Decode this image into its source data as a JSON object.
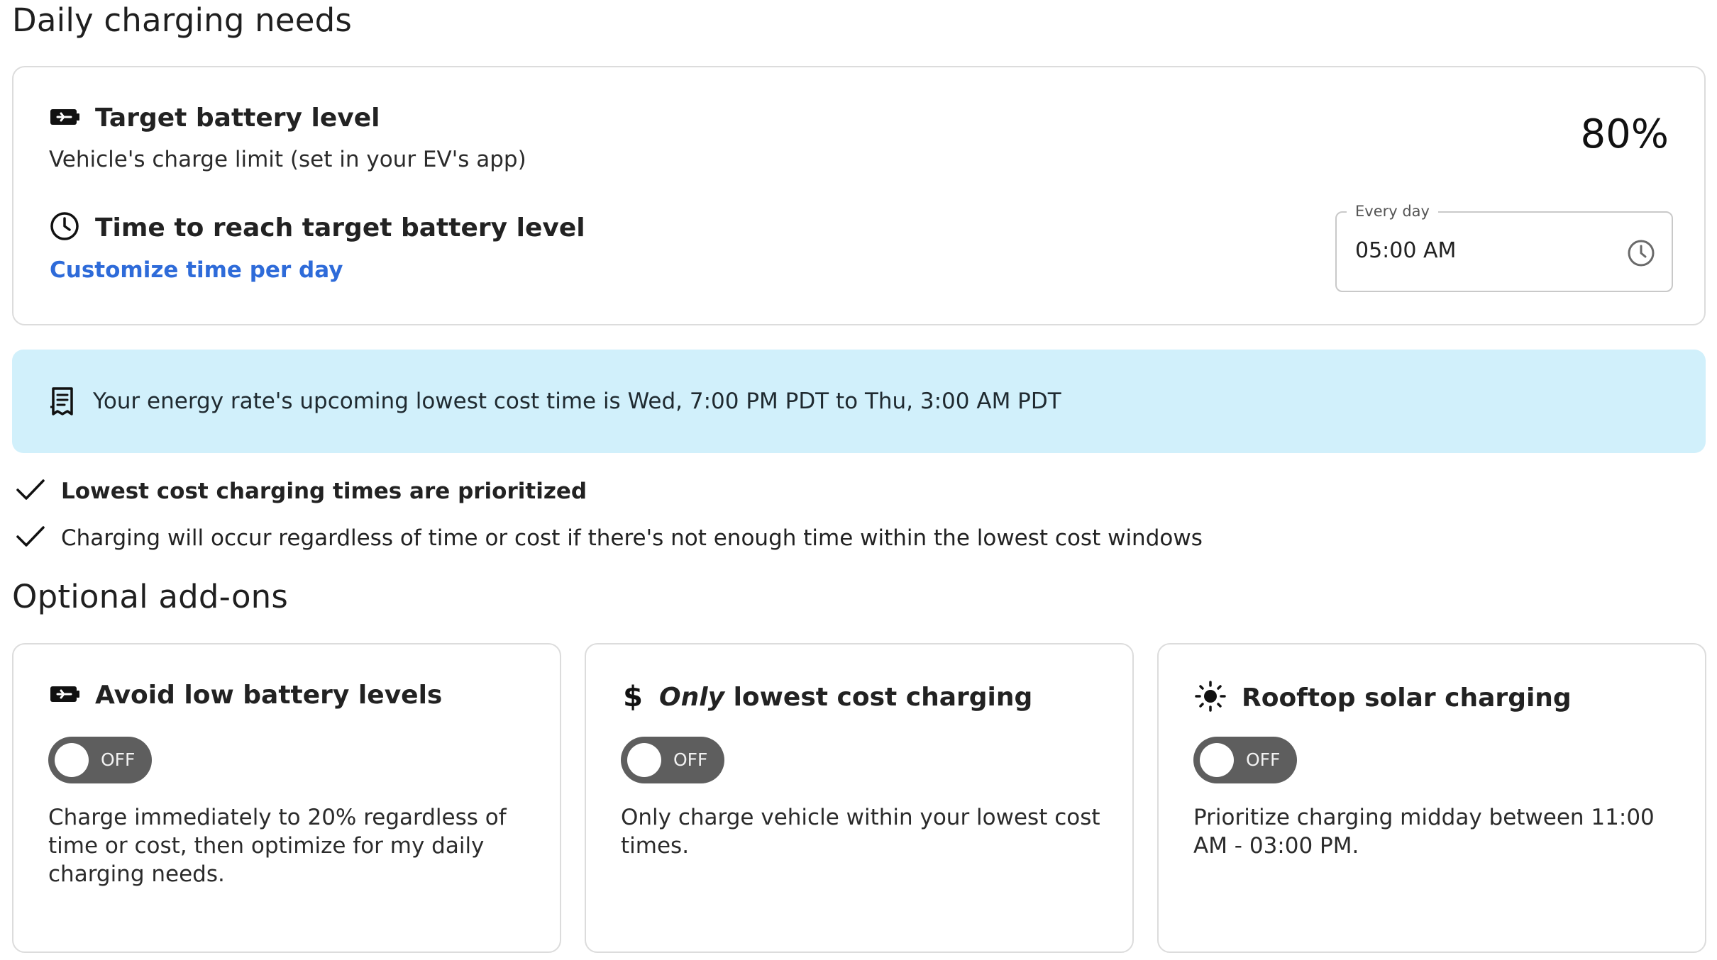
{
  "daily": {
    "title": "Daily charging needs",
    "target": {
      "icon": "battery-icon",
      "label": "Target battery level",
      "description": "Vehicle's charge limit (set in your EV's app)",
      "value": "80%"
    },
    "time": {
      "icon": "clock-icon",
      "label": "Time to reach target battery level",
      "link": "Customize time per day",
      "field_legend": "Every day",
      "field_value": "05:00 AM",
      "field_icon": "clock-icon"
    }
  },
  "banner": {
    "icon": "receipt-icon",
    "text": "Your energy rate's upcoming lowest cost time is Wed, 7:00 PM PDT to Thu, 3:00 AM PDT",
    "color": "#d1f0fb"
  },
  "checks": [
    {
      "icon": "check-icon",
      "text": "Lowest cost charging times are prioritized"
    },
    {
      "icon": "check-icon",
      "text": "Charging will occur regardless of time or cost if there's not enough time within the lowest cost windows"
    }
  ],
  "addons": {
    "title": "Optional add-ons",
    "items": [
      {
        "icon": "battery-icon",
        "title": "Avoid low battery levels",
        "toggle": "OFF",
        "description": "Charge immediately to 20% regardless of time or cost, then optimize for my daily charging needs."
      },
      {
        "icon": "dollar-icon",
        "title_emph": "Only",
        "title": "lowest cost charging",
        "toggle": "OFF",
        "description": "Only charge vehicle within your lowest cost times."
      },
      {
        "icon": "sun-icon",
        "title": "Rooftop solar charging",
        "toggle": "OFF",
        "description": "Prioritize charging midday between 11:00 AM - 03:00 PM."
      }
    ]
  },
  "colors": {
    "link": "#2e6bd9",
    "toggle_off": "#5e5e5e",
    "banner": "#d1f0fb"
  }
}
